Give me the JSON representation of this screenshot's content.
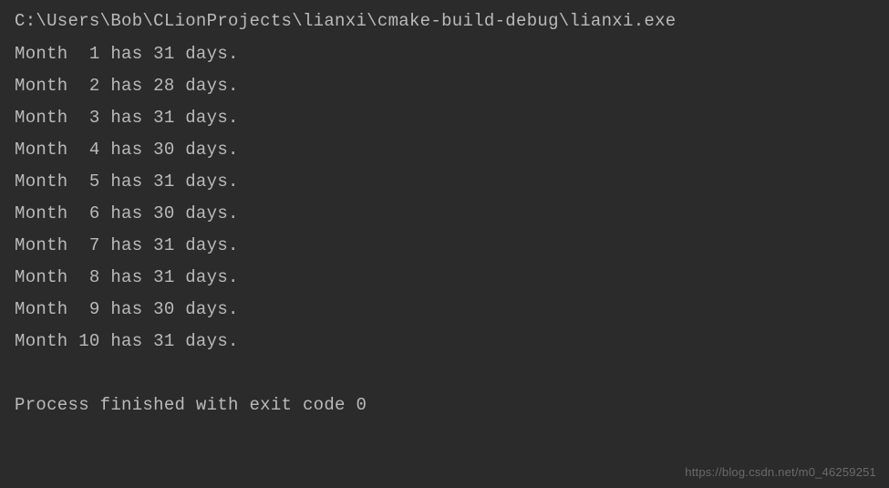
{
  "command": "C:\\Users\\Bob\\CLionProjects\\lianxi\\cmake-build-debug\\lianxi.exe",
  "output": [
    "Month  1 has 31 days.",
    "Month  2 has 28 days.",
    "Month  3 has 31 days.",
    "Month  4 has 30 days.",
    "Month  5 has 31 days.",
    "Month  6 has 30 days.",
    "Month  7 has 31 days.",
    "Month  8 has 31 days.",
    "Month  9 has 30 days.",
    "Month 10 has 31 days."
  ],
  "exit_message": "Process finished with exit code 0",
  "watermark": "https://blog.csdn.net/m0_46259251"
}
